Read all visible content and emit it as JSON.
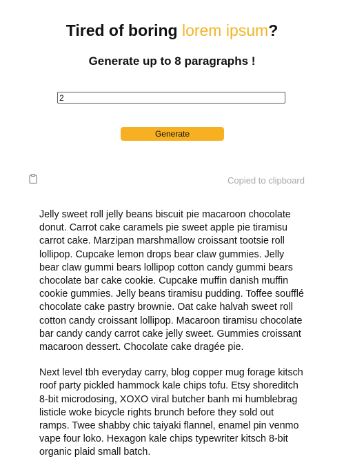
{
  "header": {
    "title_prefix": "Tired of boring ",
    "title_accent": "lorem ipsum",
    "title_suffix": "?",
    "subtitle": "Generate up to 8 paragraphs !"
  },
  "form": {
    "paragraph_count": "2",
    "generate_label": "Generate"
  },
  "clipboard": {
    "icon": "clipboard-icon",
    "status": "Copied to clipboard"
  },
  "output": {
    "paragraphs": [
      "Jelly sweet roll jelly beans biscuit pie macaroon chocolate donut. Carrot cake caramels pie sweet apple pie tiramisu carrot cake. Marzipan marshmallow croissant tootsie roll lollipop. Cupcake lemon drops bear claw gummies. Jelly bear claw gummi bears lollipop cotton candy gummi bears chocolate bar cake cookie. Cupcake muffin danish muffin cookie gummies. Jelly beans tiramisu pudding. Toffee soufflé chocolate cake pastry brownie. Oat cake halvah sweet roll cotton candy croissant lollipop. Macaroon tiramisu chocolate bar candy candy carrot cake jelly sweet. Gummies croissant macaroon dessert. Chocolate cake dragée pie.",
      "Next level tbh everyday carry, blog copper mug forage kitsch roof party pickled hammock kale chips tofu. Etsy shoreditch 8-bit microdosing, XOXO viral butcher banh mi humblebrag listicle woke bicycle rights brunch before they sold out ramps. Twee shabby chic taiyaki flannel, enamel pin venmo vape four loko. Hexagon kale chips typewriter kitsch 8-bit organic plaid small batch."
    ]
  },
  "colors": {
    "accent": "#f4b324",
    "button": "#f6b021",
    "muted_text": "#a8a8a8"
  }
}
